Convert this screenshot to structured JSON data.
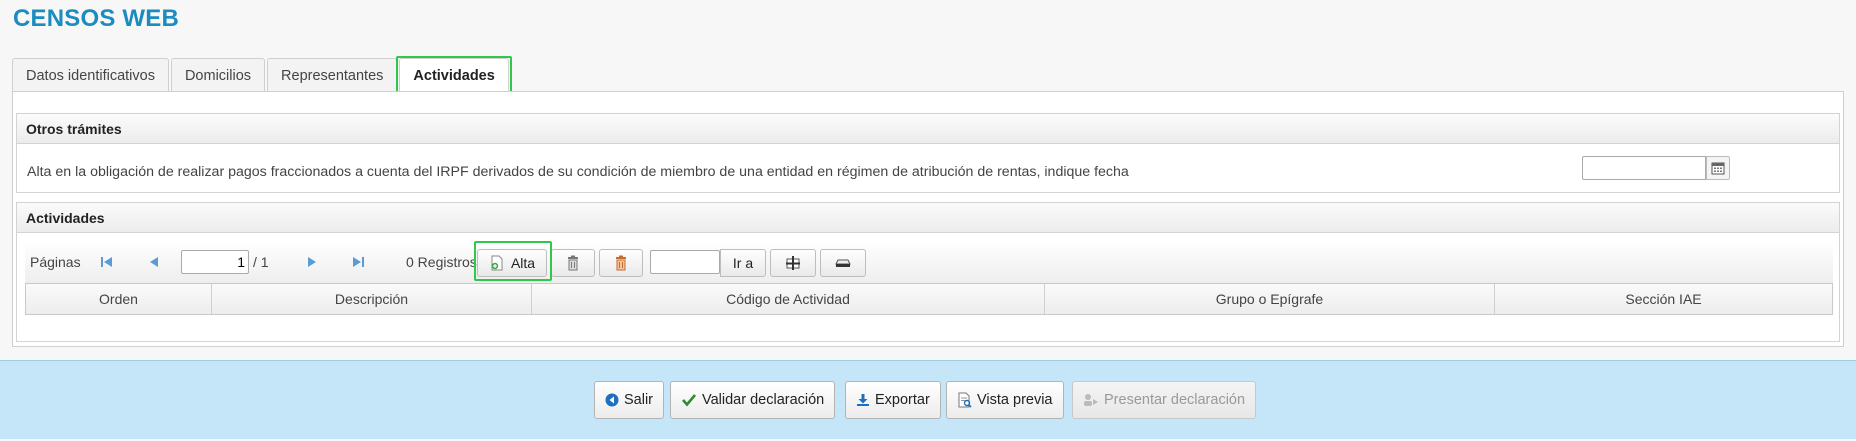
{
  "app": {
    "title": "CENSOS WEB"
  },
  "tabs": [
    {
      "label": "Datos identificativos",
      "active": false
    },
    {
      "label": "Domicilios",
      "active": false
    },
    {
      "label": "Representantes",
      "active": false
    },
    {
      "label": "Actividades",
      "active": true
    }
  ],
  "otros_tramites": {
    "title": "Otros trámites",
    "text": "Alta en la obligación de realizar pagos fraccionados a cuenta del IRPF derivados de su condición de miembro de una entidad en régimen de atribución de rentas, indique fecha",
    "date_value": ""
  },
  "actividades": {
    "title": "Actividades",
    "toolbar": {
      "paginas_label": "Páginas",
      "page_value": "1",
      "page_total": "/ 1",
      "registros": "0 Registros",
      "alta_label": "Alta",
      "goto_value": "",
      "goto_label": "Ir a"
    },
    "columns": [
      "Orden",
      "Descripción",
      "Código de Actividad",
      "Grupo o Epígrafe",
      "Sección IAE"
    ]
  },
  "footer": {
    "salir": "Salir",
    "validar": "Validar declaración",
    "exportar": "Exportar",
    "vista_previa": "Vista previa",
    "presentar": "Presentar declaración"
  },
  "colors": {
    "title": "#1a8cc0",
    "highlight": "#2ec84a",
    "footer_bg": "#c5e6f8",
    "nav_icon": "#5b9bd5"
  }
}
